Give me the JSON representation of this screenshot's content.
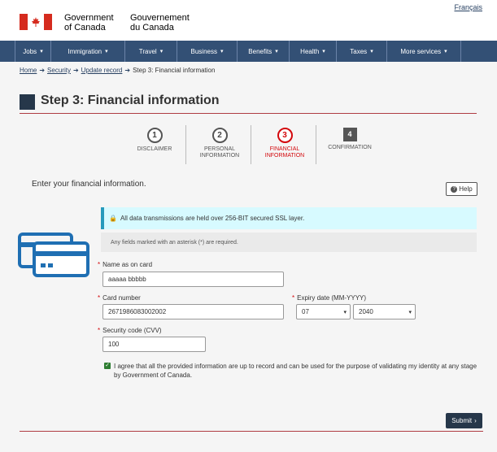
{
  "header": {
    "language_link": "Français",
    "signature_en": [
      "Government",
      "of Canada"
    ],
    "signature_fr": [
      "Gouvernement",
      "du Canada"
    ],
    "flag_color": "#d52b1e"
  },
  "menu": {
    "items": [
      {
        "label": "Jobs",
        "w": 45
      },
      {
        "label": "Immigration",
        "w": 91
      },
      {
        "label": "Travel",
        "w": 64
      },
      {
        "label": "Business",
        "w": 74
      },
      {
        "label": "Benefits",
        "w": 64
      },
      {
        "label": "Health",
        "w": 58
      },
      {
        "label": "Taxes",
        "w": 62
      },
      {
        "label": "More services",
        "w": 91
      }
    ],
    "chevron": "▾"
  },
  "breadcrumb": {
    "links": [
      "Home",
      "Security",
      "Update record"
    ],
    "current": "Step 3: Financial information"
  },
  "page_title": "Step 3: Financial information",
  "steps": [
    {
      "number": "1",
      "label": [
        "DISCLAIMER"
      ]
    },
    {
      "number": "2",
      "label": [
        "PERSONAL",
        "INFORMATION"
      ]
    },
    {
      "number": "3",
      "label": [
        "FINANCIAL",
        "INFORMATION"
      ]
    },
    {
      "number": "4",
      "label": [
        "CONFIRMATION"
      ]
    }
  ],
  "intro": "Enter your financial information.",
  "help_button": "Help",
  "ssl_notice": "All data transmissions are held over 256-BIT secured SSL layer.",
  "required_note": "Any fields marked with an asterisk (*) are required.",
  "form": {
    "name_label": "Name as on card",
    "name_value": "aaaaa bbbbb",
    "card_label": "Card number",
    "card_value": "2671986083002002",
    "expiry_label": "Expiry date (MM-YYYY)",
    "expiry_month": "07",
    "expiry_year": "2040",
    "cvv_label": "Security code (CVV)",
    "cvv_value": "100",
    "required_mark": "*"
  },
  "agreement": {
    "checked": true,
    "text": "I agree that all the provided information are up to record and can be used for the purpose of validating my identity at any stage by Government of Canada."
  },
  "submit_button": "Submit"
}
